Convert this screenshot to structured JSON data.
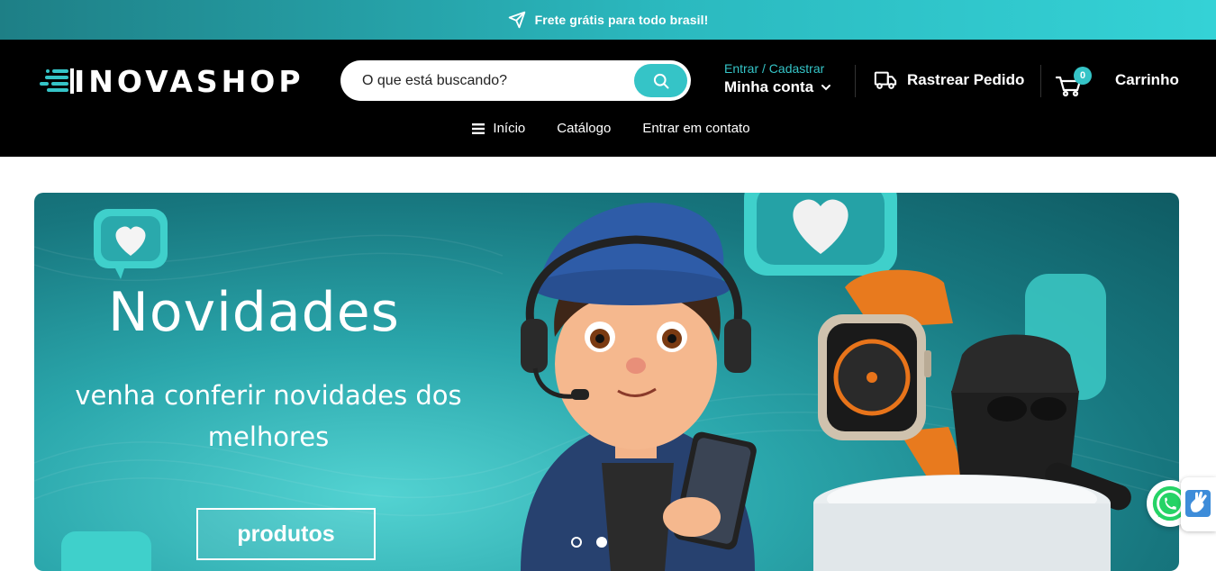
{
  "topbar": {
    "message": "Frete grátis para todo brasil!",
    "icon": "paper-plane-icon"
  },
  "header": {
    "logo_text": "INOVASHOP",
    "search": {
      "placeholder": "O que está buscando?"
    },
    "account": {
      "login_label": "Entrar / Cadastrar",
      "my_account_label": "Minha conta"
    },
    "track_label": "Rastrear Pedido",
    "cart": {
      "count": "0",
      "label": "Carrinho"
    },
    "nav": [
      {
        "label": "Início",
        "icon": "menu-icon"
      },
      {
        "label": "Catálogo"
      },
      {
        "label": "Entrar em contato"
      }
    ]
  },
  "banner": {
    "title": "Novidades",
    "subtitle": "venha conferir novidades dos melhores",
    "cta": "produtos",
    "slides": 2,
    "active_slide": 2
  },
  "colors": {
    "accent": "#35c4c7",
    "header_bg": "#000000",
    "topbar_start": "#1e7f86",
    "topbar_end": "#34d2d6"
  }
}
